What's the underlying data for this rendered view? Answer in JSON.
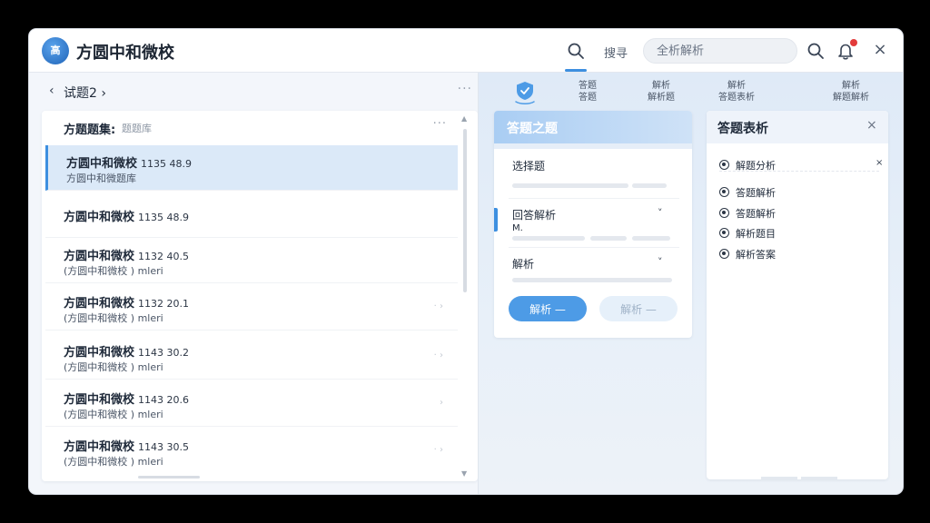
{
  "app": {
    "logo_text": "高",
    "title": "方圆中和微校"
  },
  "topbar": {
    "tab_label": "搜寻",
    "search_placeholder": "全析解析",
    "close_glyph": "×"
  },
  "left": {
    "back_glyph": "‹",
    "header_title": "试题2 ›",
    "more_glyph": "···",
    "list_title": "方题题集:",
    "list_subtitle": "题题库",
    "rows": [
      {
        "title": "方圆中和微校",
        "meta": "1135 48.9",
        "sub": "方圆中和微题库",
        "arrow": ""
      },
      {
        "title": "方圆中和微校",
        "meta": "1135 48.9",
        "sub": "",
        "arrow": ""
      },
      {
        "title": "方圆中和微校",
        "meta": "1132 40.5",
        "sub": "(方圆中和微校 ) mleri",
        "arrow": ""
      },
      {
        "title": "方圆中和微校",
        "meta": "1132 20.1",
        "sub": "(方圆中和微校 ) mleri",
        "arrow": "· ›"
      },
      {
        "title": "方圆中和微校",
        "meta": "1143 30.2",
        "sub": "(方圆中和微校 ) mleri",
        "arrow": "· ›"
      },
      {
        "title": "方圆中和微校",
        "meta": "1143 20.6",
        "sub": "(方圆中和微校 ) mleri",
        "arrow": "›"
      },
      {
        "title": "方圆中和微校",
        "meta": "1143 30.5",
        "sub": "(方圆中和微校 ) mleri",
        "arrow": "· ›"
      }
    ]
  },
  "toolbar": {
    "tools": [
      {
        "line1": "答题",
        "line2": "答题"
      },
      {
        "line1": "解析",
        "line2": "解析题"
      },
      {
        "line1": "解析",
        "line2": "答题表析"
      },
      {
        "line1": "解析",
        "line2": "解题解析"
      }
    ]
  },
  "answer": {
    "title": "答题之题",
    "field1": "选择题",
    "field2": "回答解析",
    "field2_value": "M.",
    "field3": "解析",
    "chevron": "˅",
    "primary_button": "解析 —",
    "secondary_button": "解析 —"
  },
  "analysis": {
    "title": "答题表析",
    "close_glyph": "×",
    "items": [
      "解题分析",
      "答题解析",
      "答题解析",
      "解析题目",
      "解析答案"
    ],
    "first_item_close": "×"
  },
  "colors": {
    "accent": "#3d8fe0",
    "primary_button": "#4d9be6",
    "badge": "#e23b3b"
  }
}
